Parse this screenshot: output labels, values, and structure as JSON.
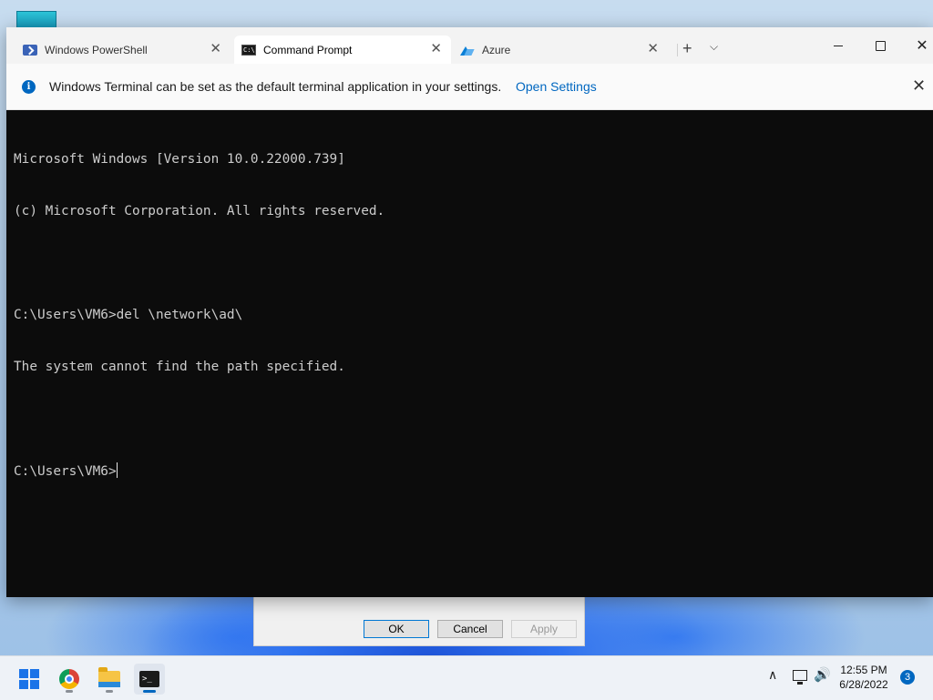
{
  "tabs": [
    {
      "label": "Windows PowerShell",
      "icon": "powershell-icon"
    },
    {
      "label": "Command Prompt",
      "icon": "cmd-icon"
    },
    {
      "label": "Azure",
      "icon": "azure-icon"
    }
  ],
  "titlebar": {
    "new_tab_glyph": "+",
    "dropdown_glyph": "⌵",
    "close_glyph": "✕",
    "tab_close_glyph": "✕"
  },
  "infobar": {
    "message": "Windows Terminal can be set as the default terminal application in your settings.",
    "link": "Open Settings",
    "info_glyph": "i"
  },
  "console": {
    "lines": [
      "Microsoft Windows [Version 10.0.22000.739]",
      "(c) Microsoft Corporation. All rights reserved.",
      "",
      "C:\\Users\\VM6>del \\network\\ad\\",
      "The system cannot find the path specified.",
      "",
      "C:\\Users\\VM6>"
    ]
  },
  "dialog": {
    "ok": "OK",
    "cancel": "Cancel",
    "apply": "Apply"
  },
  "taskbar": {
    "apps": [
      "start-icon",
      "chrome-icon",
      "file-explorer-icon",
      "terminal-icon"
    ],
    "terminal_glyph": ">_"
  },
  "tray": {
    "chevron_glyph": "∧",
    "volume_glyph": "🔊",
    "time": "12:55 PM",
    "date": "6/28/2022",
    "notification_count": "3"
  },
  "colors": {
    "accent": "#0067c0",
    "console_bg": "#0c0c0c",
    "console_fg": "#cccccc"
  }
}
